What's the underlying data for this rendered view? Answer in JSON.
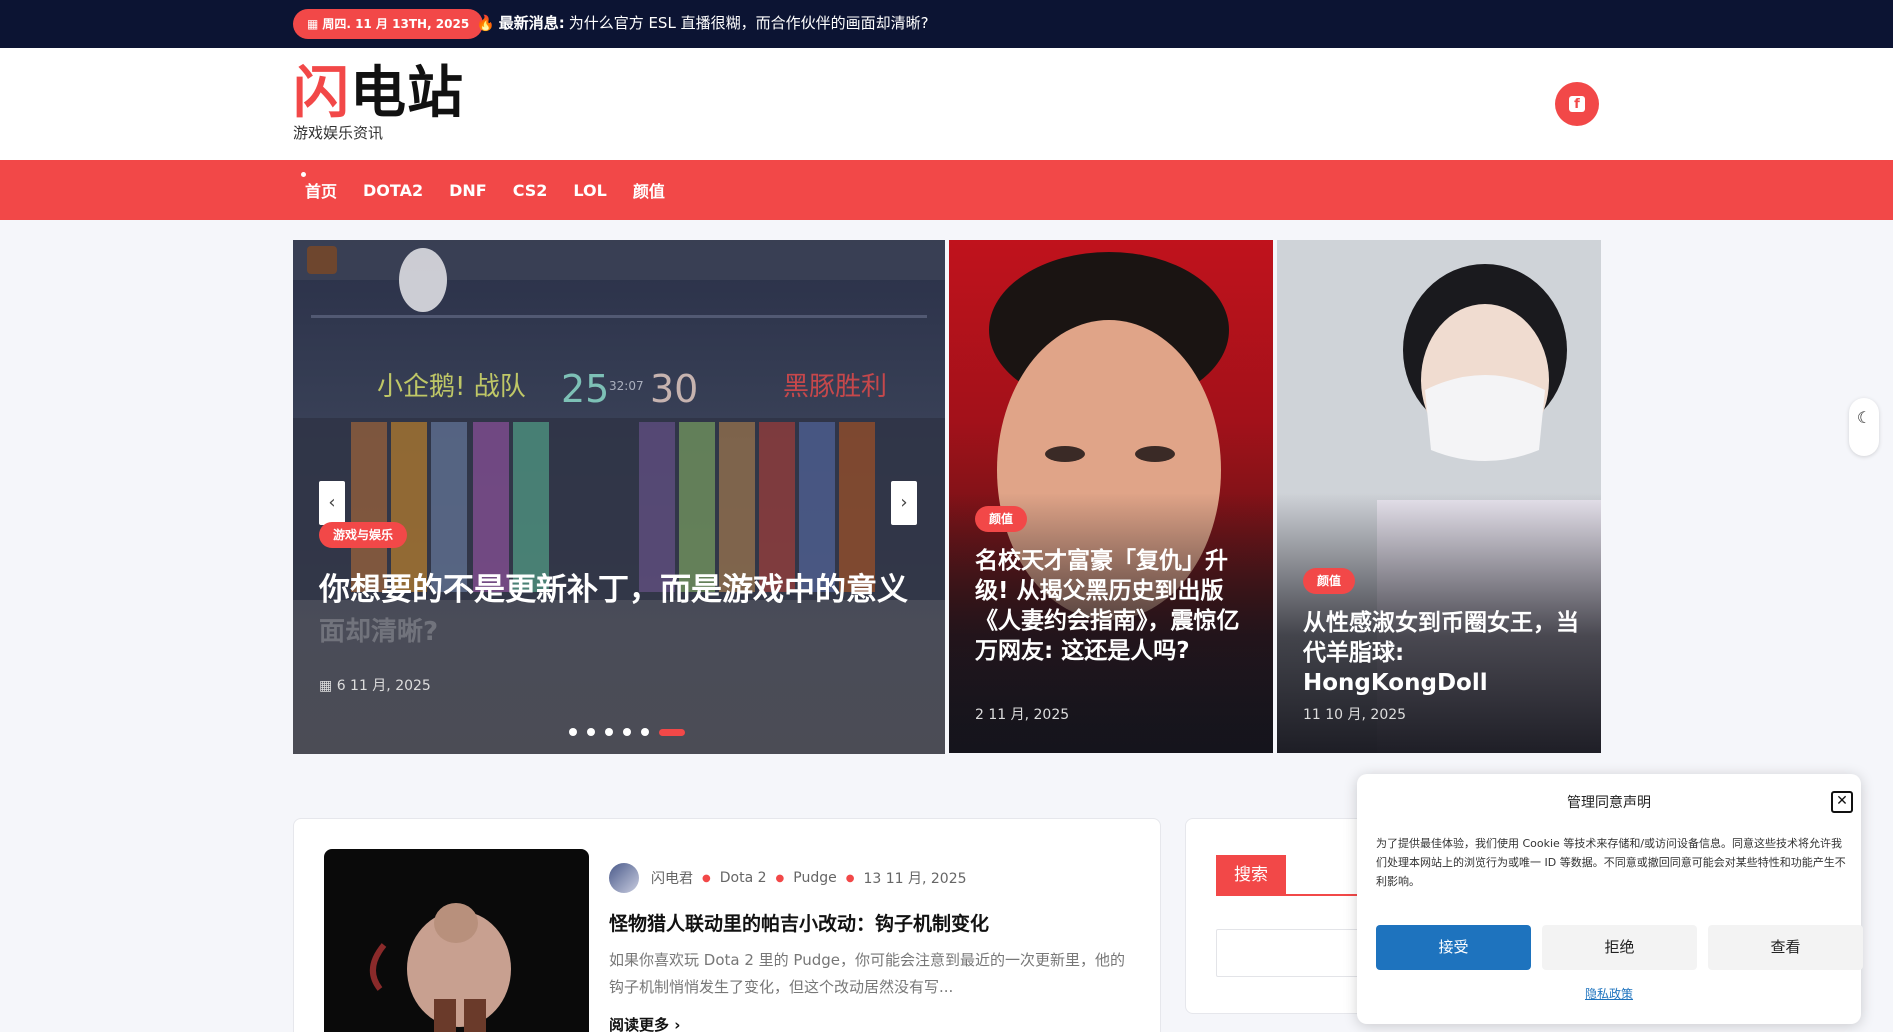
{
  "topbar": {
    "date": "周四. 11 月 13TH, 2025",
    "breaking_label": "最新消息:",
    "breaking_text": "为什么官方 ESL 直播很糊，而合作伙伴的画面却清晰?"
  },
  "header": {
    "logo_part1": "闪",
    "logo_part2": "电站",
    "tagline": "游戏娱乐资讯"
  },
  "nav": {
    "items": [
      "首页",
      "DOTA2",
      "DNF",
      "CS2",
      "LOL",
      "颜值"
    ]
  },
  "slider": {
    "category": "游戏与娱乐",
    "title": "你想要的不是更新补丁，而是游戏中的意义",
    "date": "6 11 月, 2025",
    "overlay_text": "面却清晰?",
    "team_left": "小企鹅! 战队",
    "score_left": "25",
    "score_right": "30",
    "team_right": "黑豚胜利",
    "time": "32:07",
    "slide_count": 6,
    "active_slide": 6
  },
  "cards": [
    {
      "category": "颜值",
      "title": "名校天才富豪「复仇」升级! 从揭父黑历史到出版《人妻约会指南》，震惊亿万网友: 这还是人吗?",
      "date": "2 11 月, 2025"
    },
    {
      "category": "颜值",
      "title": "从性感淑女到币圈女王，当代羊脂球: HongKongDoll",
      "date": "11 10 月, 2025"
    }
  ],
  "post": {
    "author": "闪电君",
    "tags": [
      "Dota 2",
      "Pudge"
    ],
    "date": "13 11 月, 2025",
    "title": "怪物猎人联动里的帕吉小改动：钩子机制变化",
    "excerpt": "如果你喜欢玩 Dota 2 里的 Pudge，你可能会注意到最近的一次更新里，他的钩子机制悄悄发生了变化，但这个改动居然没有写...",
    "read_more": "阅读更多"
  },
  "sidebar": {
    "search_heading": "搜索"
  },
  "consent": {
    "title": "管理同意声明",
    "text": "为了提供最佳体验，我们使用 Cookie 等技术来存储和/或访问设备信息。同意这些技术将允许我们处理本网站上的浏览行为或唯一 ID 等数据。不同意或撤回同意可能会对某些特性和功能产生不利影响。",
    "accept": "接受",
    "deny": "拒绝",
    "view": "查看",
    "privacy_link": "隐私政策"
  },
  "colors": {
    "accent": "#f24848",
    "topbar_bg": "#0c1433",
    "consent_primary": "#1e73be"
  }
}
